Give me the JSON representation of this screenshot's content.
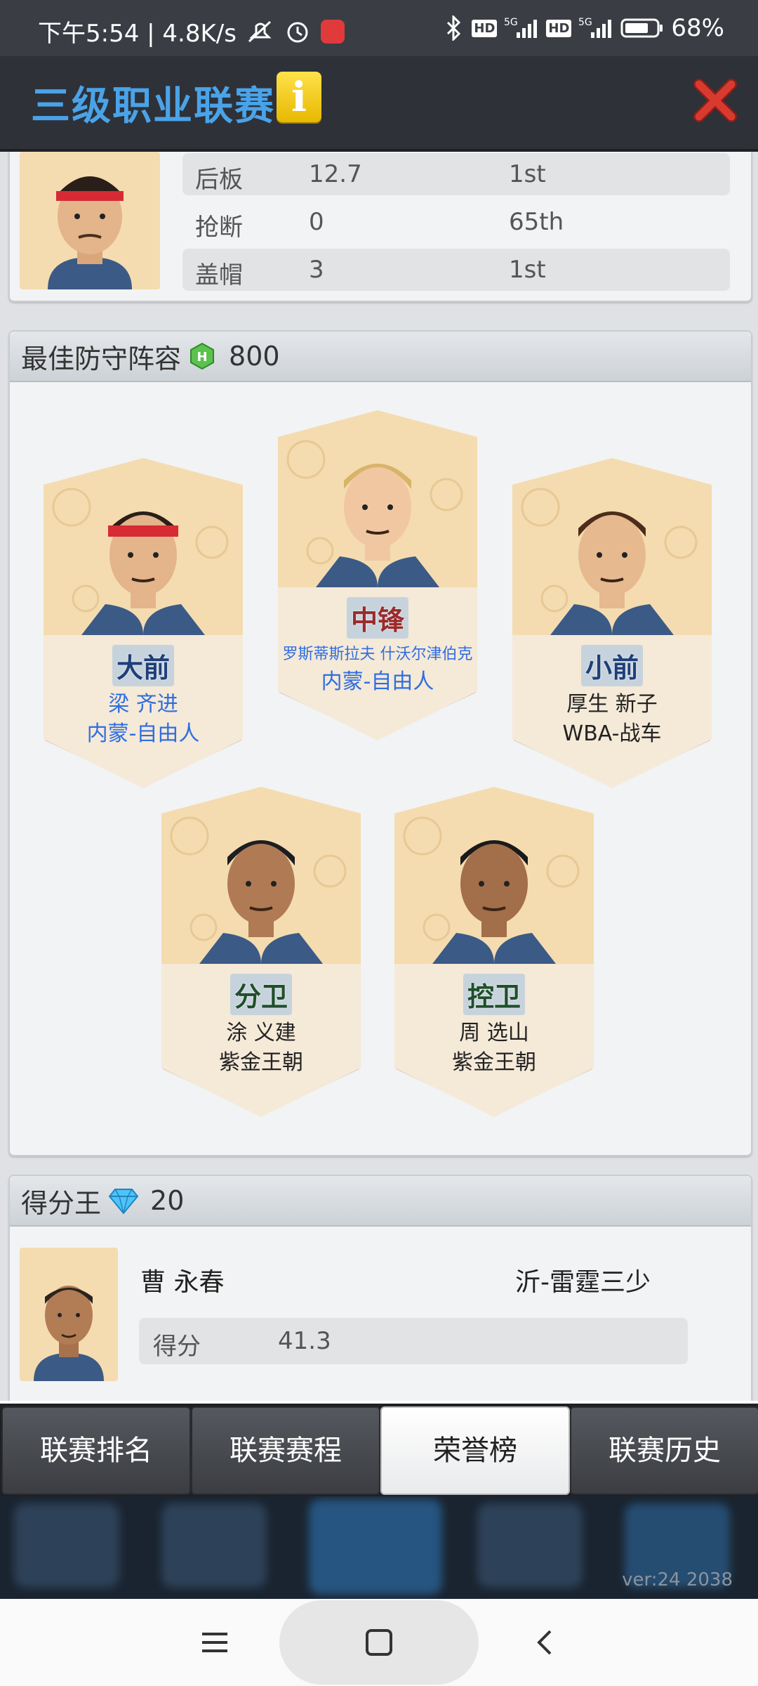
{
  "status_bar": {
    "time_speed": "下午5:54 | 4.8K/s",
    "battery": "68%"
  },
  "header": {
    "title": "三级职业联赛",
    "info_label": "i"
  },
  "top_player_stats": [
    {
      "label": "后板",
      "value": "12.7",
      "rank": "1st"
    },
    {
      "label": "抢断",
      "value": "0",
      "rank": "65th"
    },
    {
      "label": "盖帽",
      "value": "3",
      "rank": "1st"
    }
  ],
  "defense_team": {
    "title": "最佳防守阵容",
    "reward": "800",
    "reward_icon": "green-hex-coin-icon",
    "players": [
      {
        "position": "大前",
        "name": "梁 齐进",
        "team": "内蒙-自由人",
        "style": "blue"
      },
      {
        "position": "中锋",
        "name": "罗斯蒂斯拉夫 什沃尔津伯克",
        "team": "内蒙-自由人",
        "style": "blue"
      },
      {
        "position": "小前",
        "name": "厚生 新子",
        "team": "WBA-战车",
        "style": "dark"
      },
      {
        "position": "分卫",
        "name": "涂 义建",
        "team": "紫金王朝",
        "style": "dark"
      },
      {
        "position": "控卫",
        "name": "周 选山",
        "team": "紫金王朝",
        "style": "dark"
      }
    ]
  },
  "scoring_king": {
    "title": "得分王",
    "reward": "20",
    "reward_icon": "diamond-icon",
    "player_name": "曹 永春",
    "team": "沂-雷霆三少",
    "stat_label": "得分",
    "stat_value": "41.3"
  },
  "tabs": [
    {
      "label": "联赛排名",
      "active": false
    },
    {
      "label": "联赛赛程",
      "active": false
    },
    {
      "label": "荣誉榜",
      "active": true
    },
    {
      "label": "联赛历史",
      "active": false
    }
  ],
  "version": "ver:24  2038",
  "colors": {
    "title_blue": "#4aa3e8",
    "team_blue": "#2f6ee0",
    "close_red": "#d93a2f",
    "card_bg": "#f5e9d8",
    "portrait_bg": "#f4dcb0"
  }
}
